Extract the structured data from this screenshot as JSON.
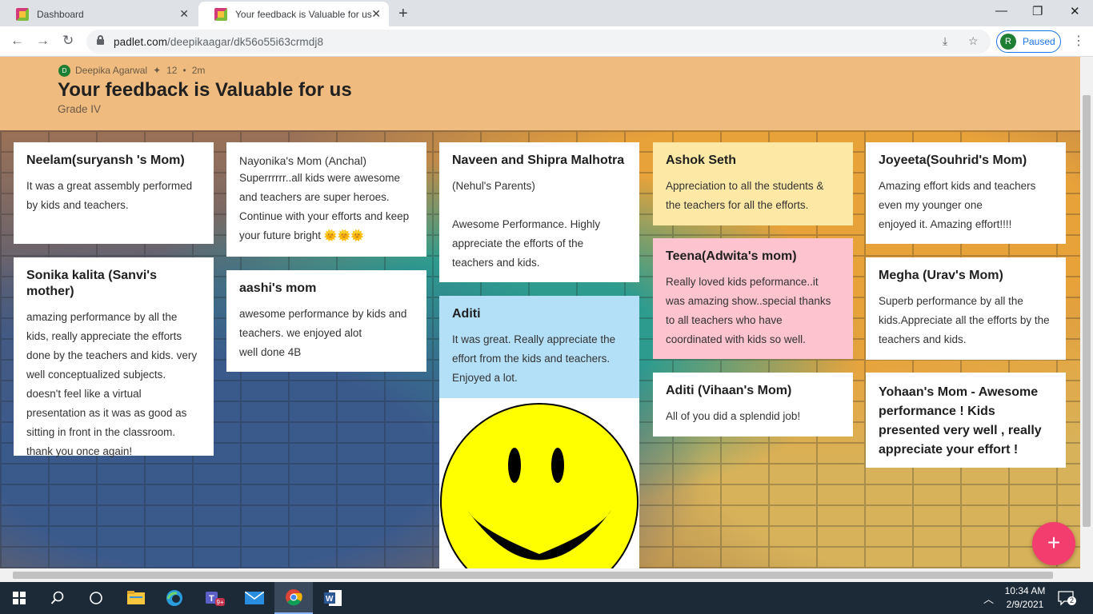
{
  "browser": {
    "tabs": [
      {
        "title": "Dashboard",
        "active": false
      },
      {
        "title": "Your feedback is Valuable for us",
        "active": true
      }
    ],
    "url_host": "padlet.com",
    "url_path": "/deepikaagar/dk56o55i63crmdj8",
    "profile_initial": "R",
    "profile_status": "Paused"
  },
  "header": {
    "author_initial": "D",
    "author": "Deepika Agarwal",
    "likes": "12",
    "time": "2m",
    "title": "Your feedback is Valuable for us",
    "subtitle": "Grade IV"
  },
  "posts": [
    {
      "title": "Neelam(suryansh 's Mom)",
      "body": "It was a great assembly performed by kids and teachers."
    },
    {
      "title": "Sonika kalita (Sanvi's mother)",
      "body": "amazing performance by all the kids, really appreciate the efforts done by the teachers and kids. very well conceptualized subjects. doesn't feel like a virtual presentation as it was as good as sitting in front in the classroom. thank you once again!"
    },
    {
      "title": "Nayonika's Mom (Anchal)",
      "body": "Superrrrrr..all kids were awesome and teachers are super heroes. Continue with your efforts and keep your future bright 🌞🌞🌞"
    },
    {
      "title": "aashi's mom",
      "body": "awesome performance by kids and teachers. we enjoyed alot\nwell done 4B"
    },
    {
      "title": "Naveen and Shipra Malhotra",
      "body": "(Nehul's Parents)\n\nAwesome Performance.  Highly appreciate the efforts of the teachers and kids."
    },
    {
      "title": "Aditi",
      "body": "It was great.  Really appreciate the effort from the kids and teachers. Enjoyed a lot."
    },
    {
      "title": "Ashok Seth",
      "body": "Appreciation to all the students & the teachers for all the efforts."
    },
    {
      "title": "Teena(Adwita's mom)",
      "body": "Really loved kids peformance..it was amazing show..special thanks to all teachers who have coordinated with kids so well."
    },
    {
      "title": "Aditi (Vihaan's Mom)",
      "body": "All of you did a splendid job!"
    },
    {
      "title": "Joyeeta(Souhrid's Mom)",
      "body": "Amazing effort kids and teachers even my younger one\nenjoyed it. Amazing effort!!!!"
    },
    {
      "title": "Megha (Urav's Mom)",
      "body": "Superb performance by all the kids.Appreciate all the efforts by the teachers and kids."
    },
    {
      "title": "Yohaan's Mom - Awesome performance ! Kids presented very well , really appreciate your effort !",
      "body": ""
    }
  ],
  "taskbar": {
    "time": "10:34 AM",
    "date": "2/9/2021",
    "notifications": "2",
    "teams_badge": "9+"
  },
  "colors": {
    "header_bg": "#f0bb7f",
    "card_yellow": "#fde8a6",
    "card_pink": "#fdc3cf",
    "card_blue": "#b3e0f7",
    "fab": "#f23d6e"
  }
}
